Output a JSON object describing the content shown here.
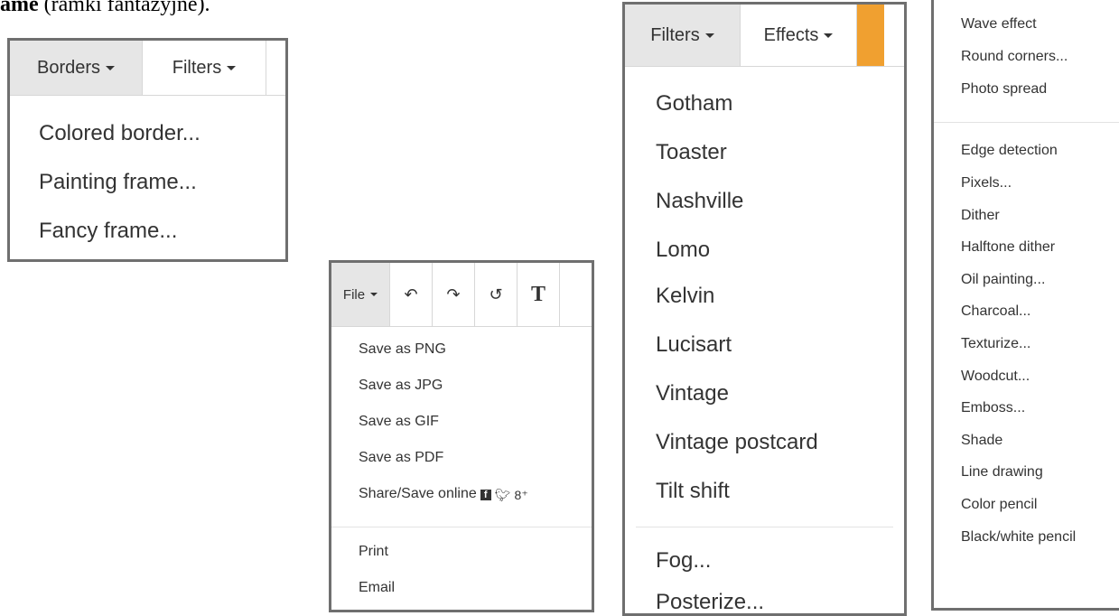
{
  "heading": {
    "bold": "ame",
    "rest": " (ramki fantazyjne)."
  },
  "borders_panel": {
    "tabs": [
      "Borders",
      "Filters"
    ],
    "items": [
      "Colored border...",
      "Painting frame...",
      "Fancy frame..."
    ]
  },
  "file_panel": {
    "menu_label": "File",
    "toolbar_icons": [
      "undo-icon",
      "redo-icon",
      "rotate-icon",
      "text-icon"
    ],
    "items": [
      "Save as PNG",
      "Save as JPG",
      "Save as GIF",
      "Save as PDF",
      "Share/Save online"
    ],
    "items2": [
      "Print",
      "Email"
    ],
    "social_icons": [
      "facebook-icon",
      "twitter-icon",
      "google-plus-icon"
    ]
  },
  "filters_panel": {
    "tabs": [
      "Filters",
      "Effects"
    ],
    "accent": "#f0a030",
    "items": [
      "Gotham",
      "Toaster",
      "Nashville",
      "Lomo",
      "Kelvin",
      "Lucisart",
      "Vintage",
      "Vintage postcard",
      "Tilt shift"
    ],
    "items2": [
      "Fog...",
      "Posterize..."
    ]
  },
  "effects_panel": {
    "items": [
      "Wave effect",
      "Round corners...",
      "Photo spread"
    ],
    "items2": [
      "Edge detection",
      "Pixels...",
      "Dither",
      "Halftone dither",
      "Oil painting...",
      "Charcoal...",
      "Texturize...",
      "Woodcut...",
      "Emboss...",
      "Shade",
      "Line drawing",
      "Color pencil",
      "Black/white pencil"
    ]
  }
}
